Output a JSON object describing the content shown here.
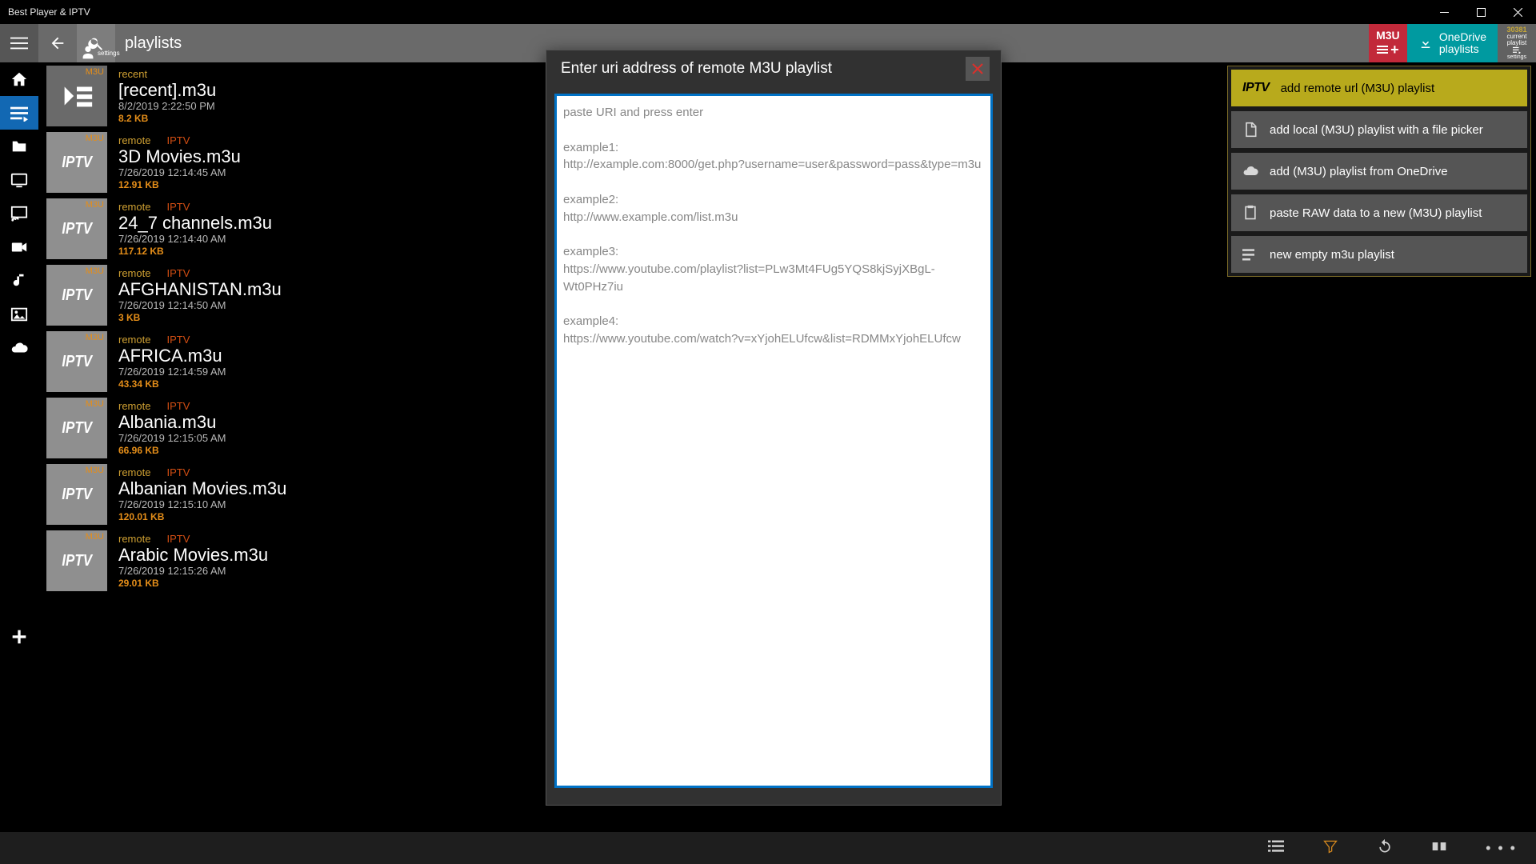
{
  "window": {
    "title": "Best Player & IPTV"
  },
  "toolbar": {
    "page_title": "playlists",
    "settings_hint": "settings",
    "m3u_label": "M3U",
    "onedrive": {
      "line1": "OneDrive",
      "line2": "playlists"
    },
    "current": {
      "count": "30381",
      "line1": "current",
      "line2": "playlist",
      "settings": "settings"
    }
  },
  "modal": {
    "title": "Enter uri address of remote M3U playlist",
    "placeholder": "paste URI and press enter\n\nexample1:\nhttp://example.com:8000/get.php?username=user&password=pass&type=m3u\n\nexample2:\nhttp://www.example.com/list.m3u\n\nexample3:\nhttps://www.youtube.com/playlist?list=PLw3Mt4FUg5YQS8kjSyjXBgL-Wt0PHz7iu\n\nexample4:\nhttps://www.youtube.com/watch?v=xYjohELUfcw&list=RDMMxYjohELUfcw"
  },
  "context_menu": {
    "items": [
      {
        "label": "add remote url (M3U) playlist"
      },
      {
        "label": "add local (M3U) playlist with a file picker"
      },
      {
        "label": "add (M3U) playlist from OneDrive"
      },
      {
        "label": "paste RAW data to a new (M3U) playlist"
      },
      {
        "label": "new empty m3u playlist"
      }
    ]
  },
  "playlists": [
    {
      "badge": "M3U",
      "type": "recent",
      "iptv": "",
      "name": "[recent].m3u",
      "date": "8/2/2019 2:22:50 PM",
      "size": "8.2 KB",
      "thumb": "recent"
    },
    {
      "badge": "M3U",
      "type": "remote",
      "iptv": "IPTV",
      "name": "3D Movies.m3u",
      "date": "7/26/2019 12:14:45 AM",
      "size": "12.91 KB",
      "thumb": "iptv"
    },
    {
      "badge": "M3U",
      "type": "remote",
      "iptv": "IPTV",
      "name": "24_7 channels.m3u",
      "date": "7/26/2019 12:14:40 AM",
      "size": "117.12 KB",
      "thumb": "iptv"
    },
    {
      "badge": "M3U",
      "type": "remote",
      "iptv": "IPTV",
      "name": "AFGHANISTAN.m3u",
      "date": "7/26/2019 12:14:50 AM",
      "size": "3 KB",
      "thumb": "iptv"
    },
    {
      "badge": "M3U",
      "type": "remote",
      "iptv": "IPTV",
      "name": "AFRICA.m3u",
      "date": "7/26/2019 12:14:59 AM",
      "size": "43.34 KB",
      "thumb": "iptv"
    },
    {
      "badge": "M3U",
      "type": "remote",
      "iptv": "IPTV",
      "name": "Albania.m3u",
      "date": "7/26/2019 12:15:05 AM",
      "size": "66.96 KB",
      "thumb": "iptv"
    },
    {
      "badge": "M3U",
      "type": "remote",
      "iptv": "IPTV",
      "name": "Albanian Movies.m3u",
      "date": "7/26/2019 12:15:10 AM",
      "size": "120.01 KB",
      "thumb": "iptv"
    },
    {
      "badge": "M3U",
      "type": "remote",
      "iptv": "IPTV",
      "name": "Arabic Movies.m3u",
      "date": "7/26/2019 12:15:26 AM",
      "size": "29.01 KB",
      "thumb": "iptv"
    }
  ]
}
